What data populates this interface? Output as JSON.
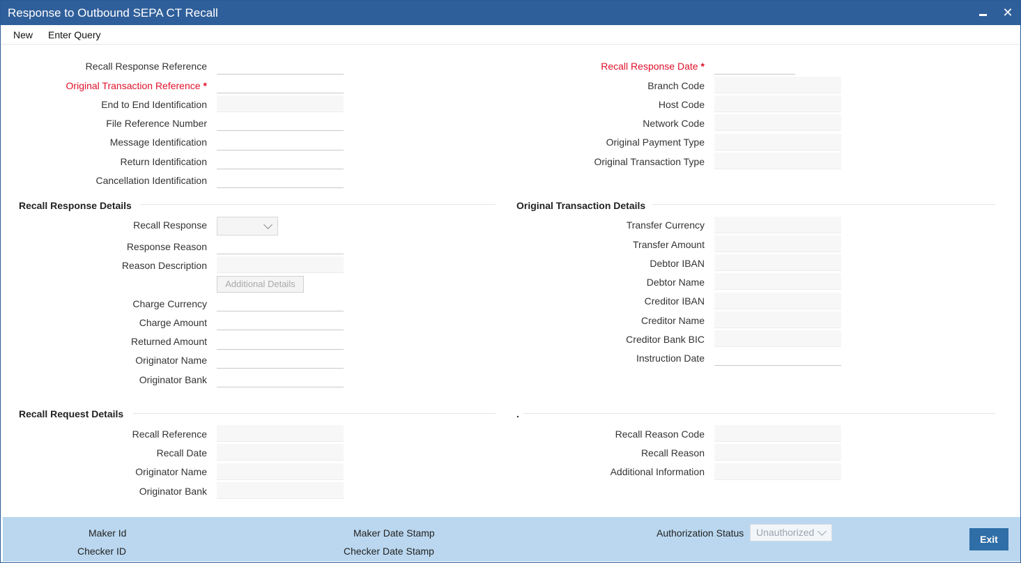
{
  "window": {
    "title": "Response to Outbound SEPA CT Recall"
  },
  "menu": {
    "new": "New",
    "enter_query": "Enter Query"
  },
  "header_left": {
    "recall_response_reference": "Recall Response Reference",
    "original_transaction_reference": "Original Transaction Reference",
    "end_to_end_identification": "End to End Identification",
    "file_reference_number": "File Reference Number",
    "message_identification": "Message Identification",
    "return_identification": "Return Identification",
    "cancellation_identification": "Cancellation Identification"
  },
  "header_right": {
    "recall_response_date": "Recall Response Date",
    "branch_code": "Branch Code",
    "host_code": "Host Code",
    "network_code": "Network Code",
    "original_payment_type": "Original Payment Type",
    "original_transaction_type": "Original Transaction Type"
  },
  "required_marker": "*",
  "recall_response_details": {
    "title": "Recall Response Details",
    "recall_response": "Recall Response",
    "response_reason": "Response Reason",
    "reason_description": "Reason Description",
    "additional_details_button": "Additional Details",
    "charge_currency": "Charge Currency",
    "charge_amount": "Charge Amount",
    "returned_amount": "Returned Amount",
    "originator_name": "Originator Name",
    "originator_bank": "Originator Bank"
  },
  "original_transaction_details": {
    "title": "Original Transaction Details",
    "transfer_currency": "Transfer Currency",
    "transfer_amount": "Transfer Amount",
    "debtor_iban": "Debtor IBAN",
    "debtor_name": "Debtor Name",
    "creditor_iban": "Creditor IBAN",
    "creditor_name": "Creditor Name",
    "creditor_bank_bic": "Creditor Bank BIC",
    "instruction_date": "Instruction Date"
  },
  "recall_request_details": {
    "title": "Recall Request Details",
    "recall_reference": "Recall Reference",
    "recall_date": "Recall Date",
    "originator_name": "Originator Name",
    "originator_bank": "Originator Bank"
  },
  "recall_reason_section": {
    "title": ".",
    "recall_reason_code": "Recall Reason Code",
    "recall_reason": "Recall Reason",
    "additional_information": "Additional Information"
  },
  "footer": {
    "maker_id": "Maker Id",
    "checker_id": "Checker ID",
    "maker_date_stamp": "Maker Date Stamp",
    "checker_date_stamp": "Checker Date Stamp",
    "authorization_status": "Authorization Status",
    "authorization_status_value": "Unauthorized",
    "exit_button": "Exit"
  },
  "colors": {
    "titlebar": "#2f5f9a",
    "required": "#e0102a",
    "footer": "#bad7ef",
    "exit_button": "#2f6ea7"
  }
}
